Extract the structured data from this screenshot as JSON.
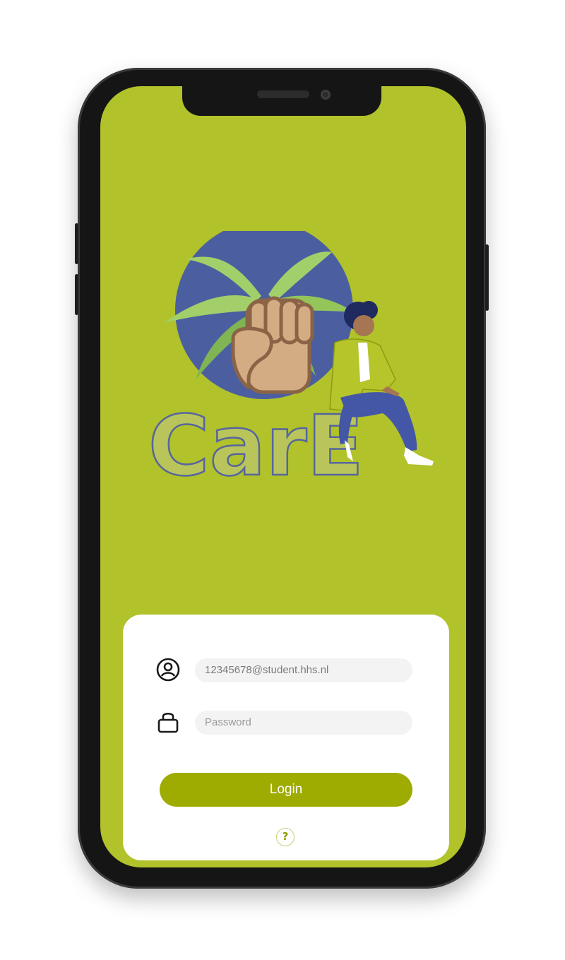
{
  "app": {
    "brand_text": "CarE"
  },
  "login": {
    "email_value": "12345678@student.hhs.nl",
    "password_placeholder": "Password",
    "login_label": "Login",
    "help_glyph": "?"
  },
  "icons": {
    "email": "user-circle-icon",
    "password": "lock-icon",
    "help": "question-icon"
  },
  "colors": {
    "screen_background": "#b1c22a",
    "button": "#9eab00",
    "globe": "#4b5fa0",
    "leaves": "#a3cf6a",
    "fist": "#d3ac84",
    "jacket": "#b5c52a",
    "pants": "#4357a6"
  }
}
